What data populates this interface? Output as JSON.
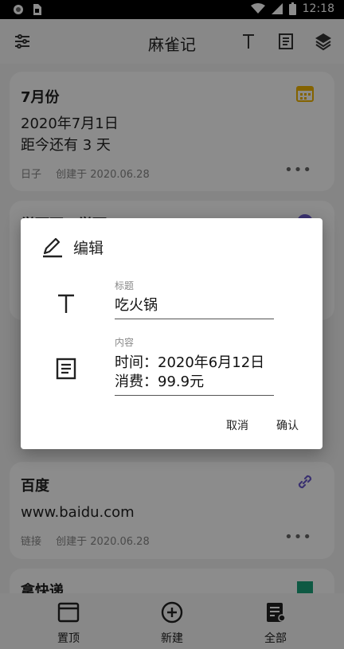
{
  "status_bar": {
    "time": "12:18"
  },
  "app_bar": {
    "title": "麻雀记",
    "icons": [
      "tune-icon",
      "text-icon",
      "document-icon",
      "layers-icon"
    ]
  },
  "cards": [
    {
      "title": "7月份",
      "body_line1": "2020年7月1日",
      "body_line2": "距今还有 3 天",
      "type": "日子",
      "created": "创建于 2020.06.28",
      "more": "•••",
      "icon": "calendar-icon",
      "accent": "#f0b400"
    },
    {
      "title": "学而不…学而…"
    },
    {
      "title": "百度",
      "body_line1": "www.baidu.com",
      "type": "链接",
      "created": "创建于 2020.06.28",
      "more": "•••",
      "icon": "link-icon",
      "accent": "#6a5acd"
    },
    {
      "title": "拿快递",
      "icon": "note-icon",
      "accent": "#1aa37a"
    }
  ],
  "bottom_nav": [
    {
      "label": "置顶",
      "icon": "pin-top-icon"
    },
    {
      "label": "新建",
      "icon": "add-circle-icon"
    },
    {
      "label": "全部",
      "icon": "all-notes-icon"
    }
  ],
  "dialog": {
    "title": "编辑",
    "title_label": "标题",
    "title_value": "吃火锅",
    "content_label": "内容",
    "content_value": "时间：2020年6月12日\n消费：99.9元",
    "cancel_label": "取消",
    "confirm_label": "确认"
  }
}
